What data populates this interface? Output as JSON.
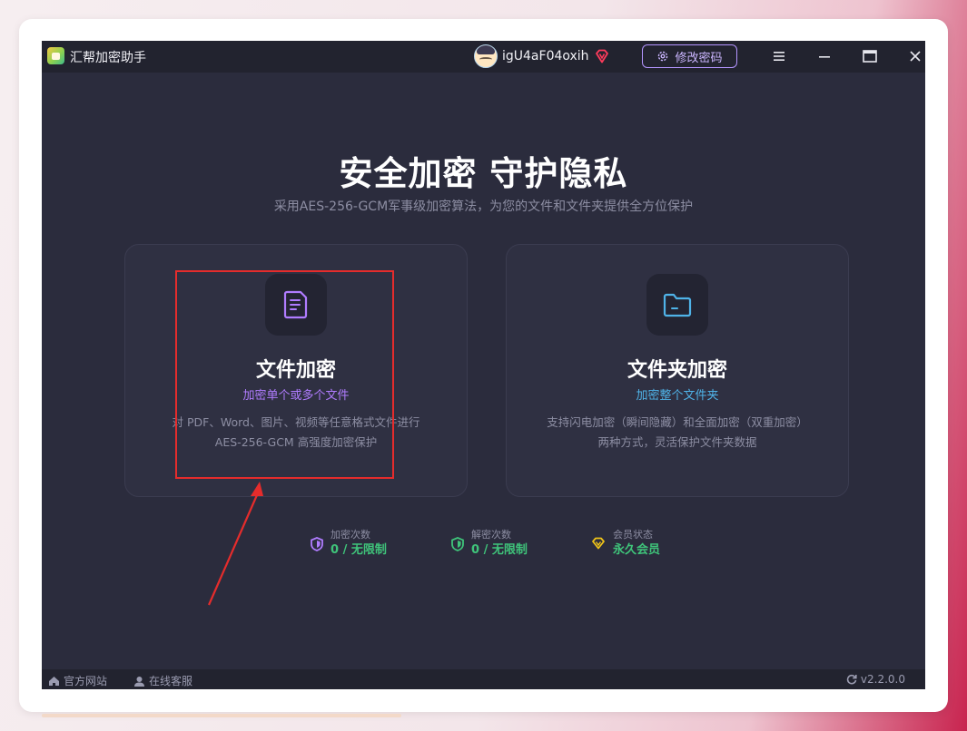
{
  "app": {
    "title": "汇帮加密助手",
    "username": "igU4aF04oxih"
  },
  "toolbar": {
    "change_password_label": "修改密码"
  },
  "hero": {
    "title": "安全加密 守护隐私",
    "subtitle": "采用AES-256-GCM军事级加密算法，为您的文件和文件夹提供全方位保护"
  },
  "cards": [
    {
      "title": "文件加密",
      "subtitle": "加密单个或多个文件",
      "desc_line1": "对 PDF、Word、图片、视频等任意格式文件进行",
      "desc_line2": "AES-256-GCM 高强度加密保护",
      "icon": "document-icon",
      "accent": "#b07cff"
    },
    {
      "title": "文件夹加密",
      "subtitle": "加密整个文件夹",
      "desc_line1": "支持闪电加密（瞬间隐藏）和全面加密（双重加密）",
      "desc_line2": "两种方式，灵活保护文件夹数据",
      "icon": "folder-icon",
      "accent": "#4fb3e8"
    }
  ],
  "stats": [
    {
      "label": "加密次数",
      "value": "0 / 无限制",
      "icon": "shield-icon",
      "color": "#b07cff"
    },
    {
      "label": "解密次数",
      "value": "0 / 无限制",
      "icon": "shield-icon",
      "color": "#3fc47a"
    },
    {
      "label": "会员状态",
      "value": "永久会员",
      "icon": "diamond-icon",
      "color": "#f0c419"
    }
  ],
  "footer": {
    "website_label": "官方网站",
    "support_label": "在线客服",
    "version": "v2.2.0.0"
  },
  "colors": {
    "value_green": "#3fc47a",
    "annotation_red": "#e52c2c"
  }
}
